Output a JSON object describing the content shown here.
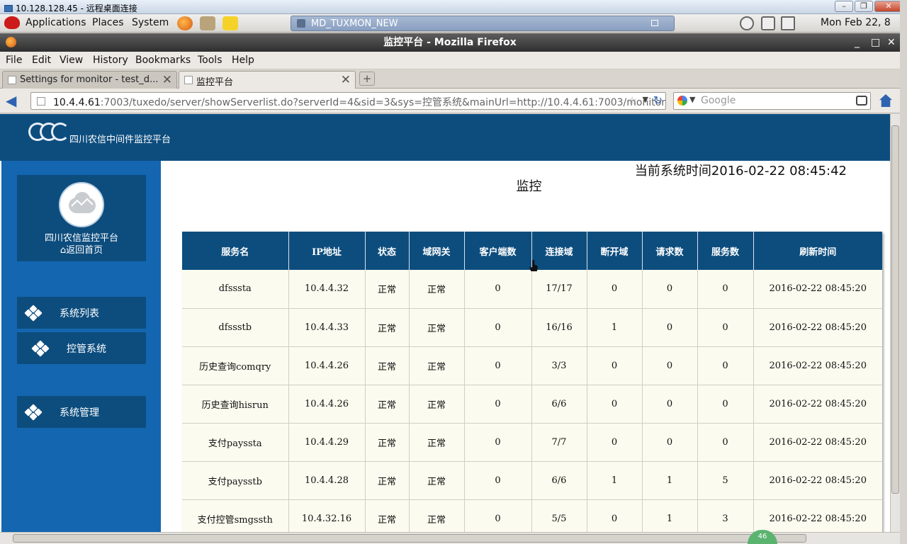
{
  "rdp": {
    "title": "10.128.128.45 - 远程桌面连接"
  },
  "gnome": {
    "applications": "Applications",
    "places": "Places",
    "system": "System",
    "task_window": "MD_TUXMON_NEW",
    "clock": "Mon Feb 22,  8"
  },
  "firefox": {
    "window_title": "监控平台 - Mozilla Firefox",
    "menu": [
      "File",
      "Edit",
      "View",
      "History",
      "Bookmarks",
      "Tools",
      "Help"
    ],
    "tabs": [
      {
        "title": "Settings for monitor - test_d..."
      },
      {
        "title": "监控平台"
      }
    ],
    "url_host": "10.4.4.61",
    "url_rest": ":7003/tuxedo/server/showServerlist.do?serverId=4&sid=3&sys=控管系统&mainUrl=http://10.4.4.61:7003/monitor",
    "search_placeholder": "Google"
  },
  "page": {
    "header_title": "四川农信中间件监控平台",
    "profile_title": "四川农信监控平台",
    "home_link": "返回首页",
    "menu": [
      "系统列表",
      "控管系统",
      "系统管理"
    ],
    "system_time": "当前系统时间2016-02-22 08:45:42",
    "title": "监控",
    "table": {
      "headers": [
        "服务名",
        "IP地址",
        "状态",
        "域网关",
        "客户端数",
        "连接域",
        "断开域",
        "请求数",
        "服务数",
        "刷新时间"
      ],
      "rows": [
        [
          "dfsssta",
          "10.4.4.32",
          "正常",
          "正常",
          "0",
          "17/17",
          "0",
          "0",
          "0",
          "2016-02-22 08:45:20"
        ],
        [
          "dfssstb",
          "10.4.4.33",
          "正常",
          "正常",
          "0",
          "16/16",
          "1",
          "0",
          "0",
          "2016-02-22 08:45:20"
        ],
        [
          "历史查询comqry",
          "10.4.4.26",
          "正常",
          "正常",
          "0",
          "3/3",
          "0",
          "0",
          "0",
          "2016-02-22 08:45:20"
        ],
        [
          "历史查询hisrun",
          "10.4.4.26",
          "正常",
          "正常",
          "0",
          "6/6",
          "0",
          "0",
          "0",
          "2016-02-22 08:45:20"
        ],
        [
          "支付payssta",
          "10.4.4.29",
          "正常",
          "正常",
          "0",
          "7/7",
          "0",
          "0",
          "0",
          "2016-02-22 08:45:20"
        ],
        [
          "支付paysstb",
          "10.4.4.28",
          "正常",
          "正常",
          "0",
          "6/6",
          "1",
          "1",
          "5",
          "2016-02-22 08:45:20"
        ],
        [
          "支付控管smgssth",
          "10.4.32.16",
          "正常",
          "正常",
          "0",
          "5/5",
          "0",
          "1",
          "3",
          "2016-02-22 08:45:20"
        ]
      ]
    }
  },
  "badge": "46",
  "colors": {
    "header_blue": "#0d4d7e",
    "sidebar_blue": "#1466b0",
    "row_bg": "#fbfbef"
  }
}
